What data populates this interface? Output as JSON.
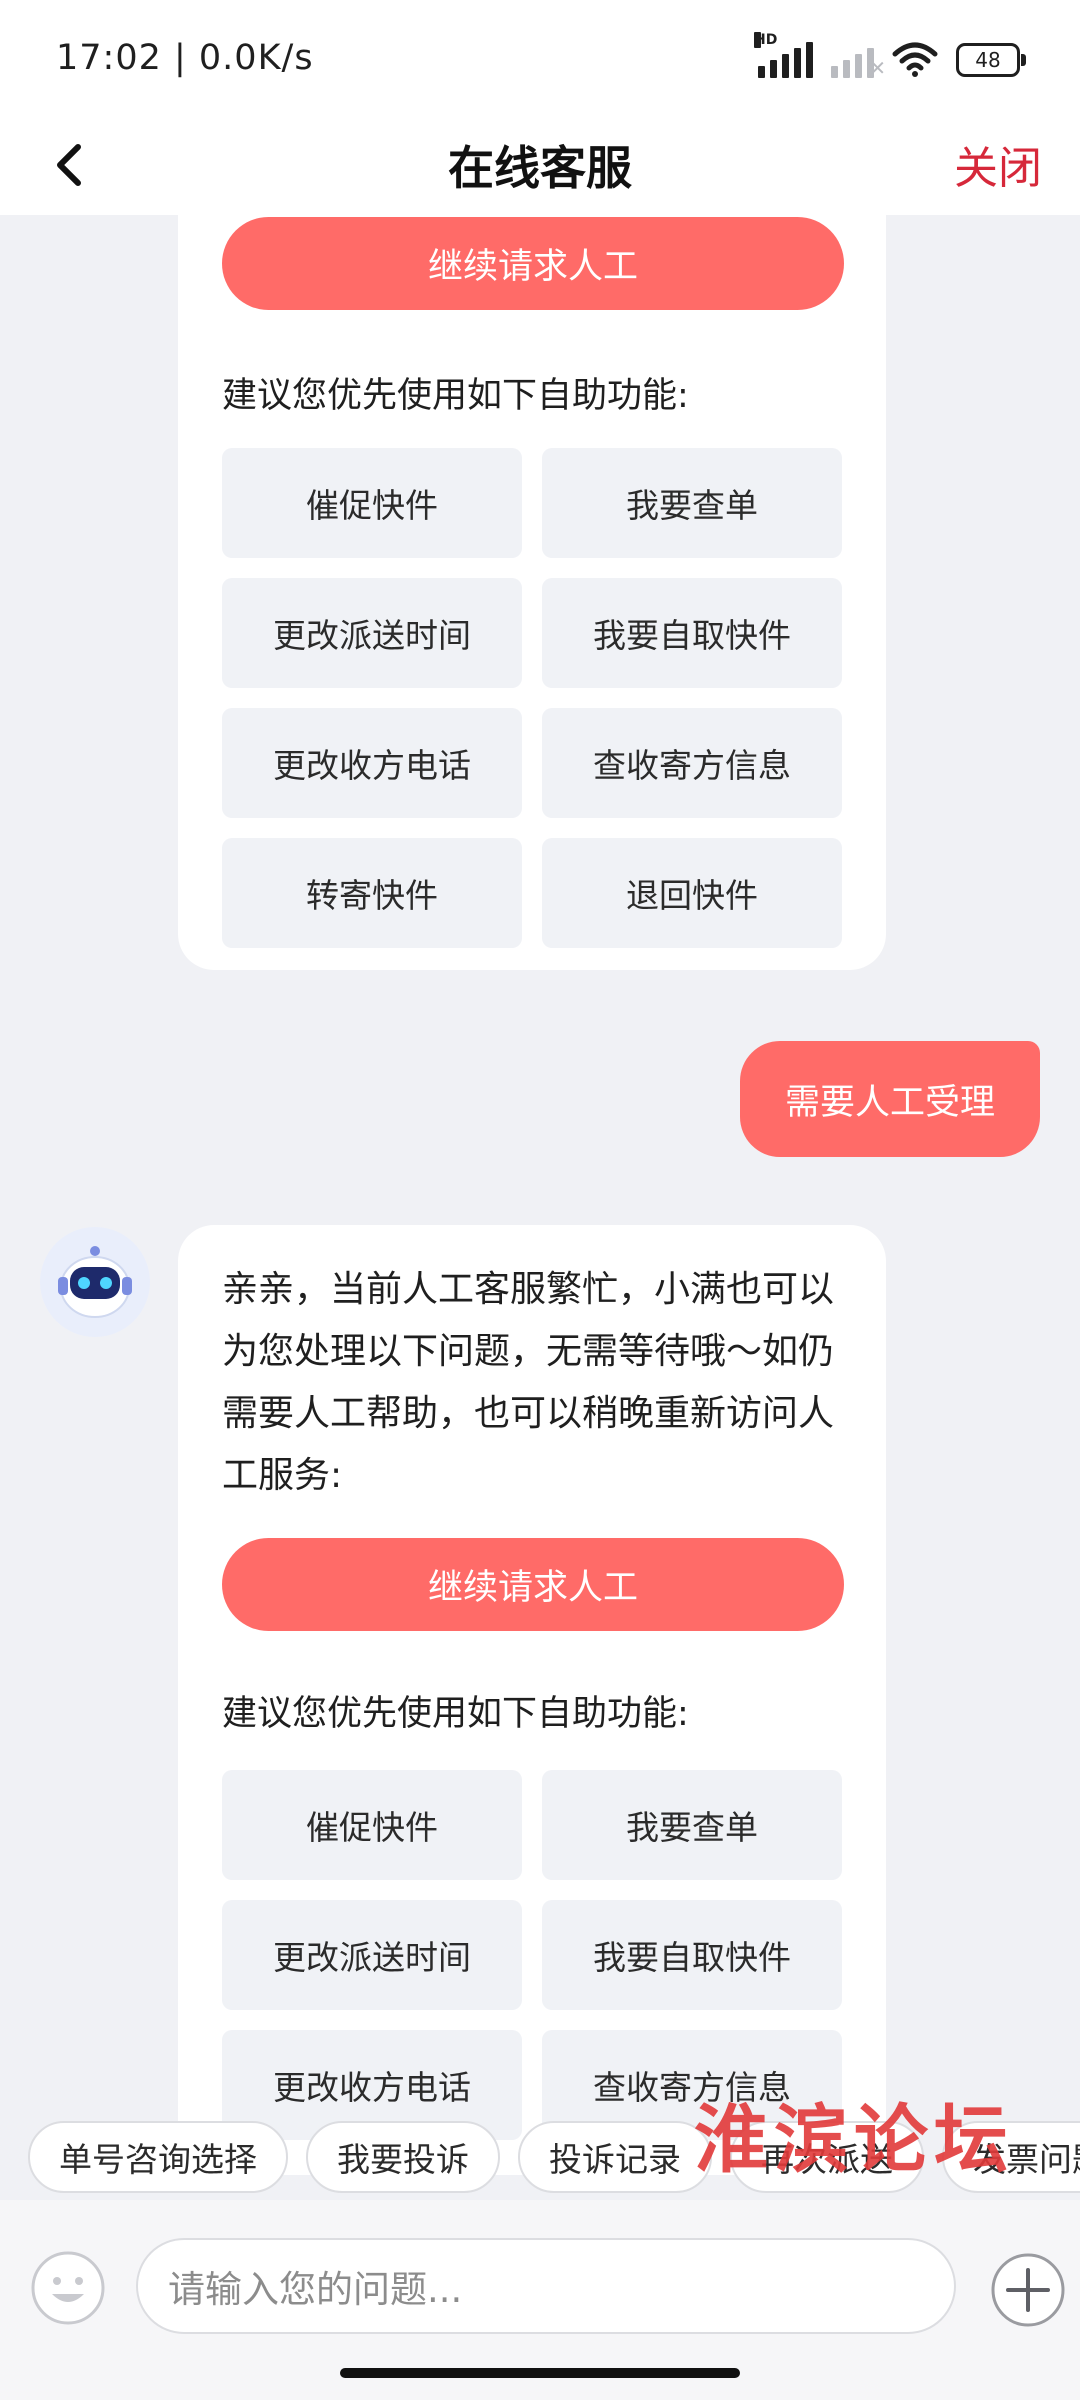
{
  "status_bar": {
    "time": "17:02 | 0.0K/s",
    "hd": "HD",
    "battery": "48"
  },
  "header": {
    "title": "在线客服",
    "close_label": "关闭"
  },
  "card1": {
    "continue_button": "继续请求人工",
    "suggest_label": "建议您优先使用如下自助功能:",
    "functions": [
      "催促快件",
      "我要查单",
      "更改派送时间",
      "我要自取快件",
      "更改收方电话",
      "查收寄方信息",
      "转寄快件",
      "退回快件"
    ]
  },
  "user_message": "需要人工受理",
  "card2": {
    "message": "亲亲，当前人工客服繁忙，小满也可以为您处理以下问题，无需等待哦～如仍需要人工帮助，也可以稍晚重新访问人工服务:",
    "continue_button": "继续请求人工",
    "suggest_label": "建议您优先使用如下自助功能:",
    "functions": [
      "催促快件",
      "我要查单",
      "更改派送时间",
      "我要自取快件",
      "更改收方电话",
      "查收寄方信息"
    ]
  },
  "quick_chips": [
    "单号咨询选择",
    "我要投诉",
    "投诉记录",
    "再次派送",
    "发票问题"
  ],
  "watermark": "淮滨论坛",
  "input": {
    "placeholder": "请输入您的问题..."
  },
  "colors": {
    "accent": "#ff6b68",
    "close": "#d6283a"
  }
}
